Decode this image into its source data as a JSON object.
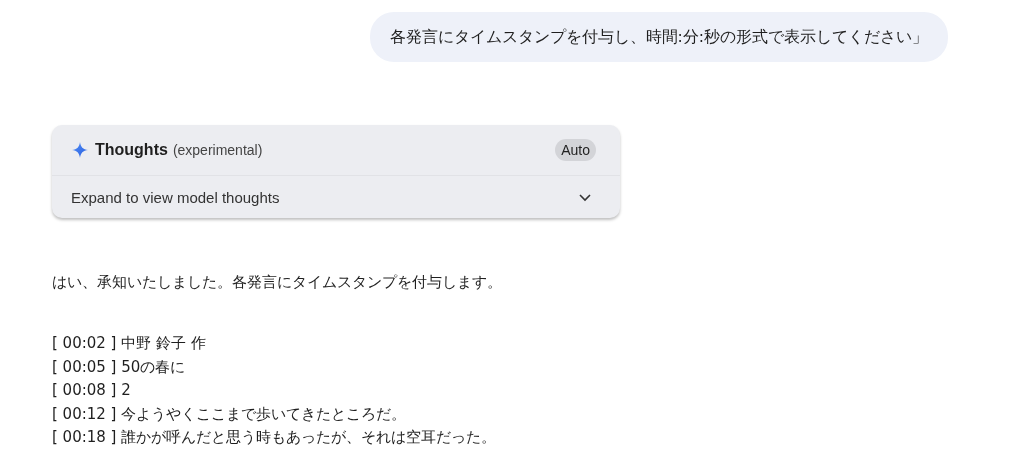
{
  "user_message": "各発言にタイムスタンプを付与し、時間:分:秒の形式で表示してください」",
  "thoughts": {
    "title": "Thoughts",
    "note": "(experimental)",
    "badge": "Auto",
    "expand_label": "Expand to view model thoughts",
    "expanded": false
  },
  "response": {
    "intro": "はい、承知いたしました。各発言にタイムスタンプを付与します。",
    "lines": [
      {
        "time": "[ 00:02 ]",
        "text": "中野 鈴子 作"
      },
      {
        "time": "[ 00:05 ]",
        "text": "50の春に"
      },
      {
        "time": "[ 00:08 ]",
        "text": "2"
      },
      {
        "time": "[ 00:12 ]",
        "text": "今ようやくここまで歩いてきたところだ。"
      },
      {
        "time": "[ 00:18 ]",
        "text": "誰かが呼んだと思う時もあったが、それは空耳だった。"
      }
    ]
  }
}
